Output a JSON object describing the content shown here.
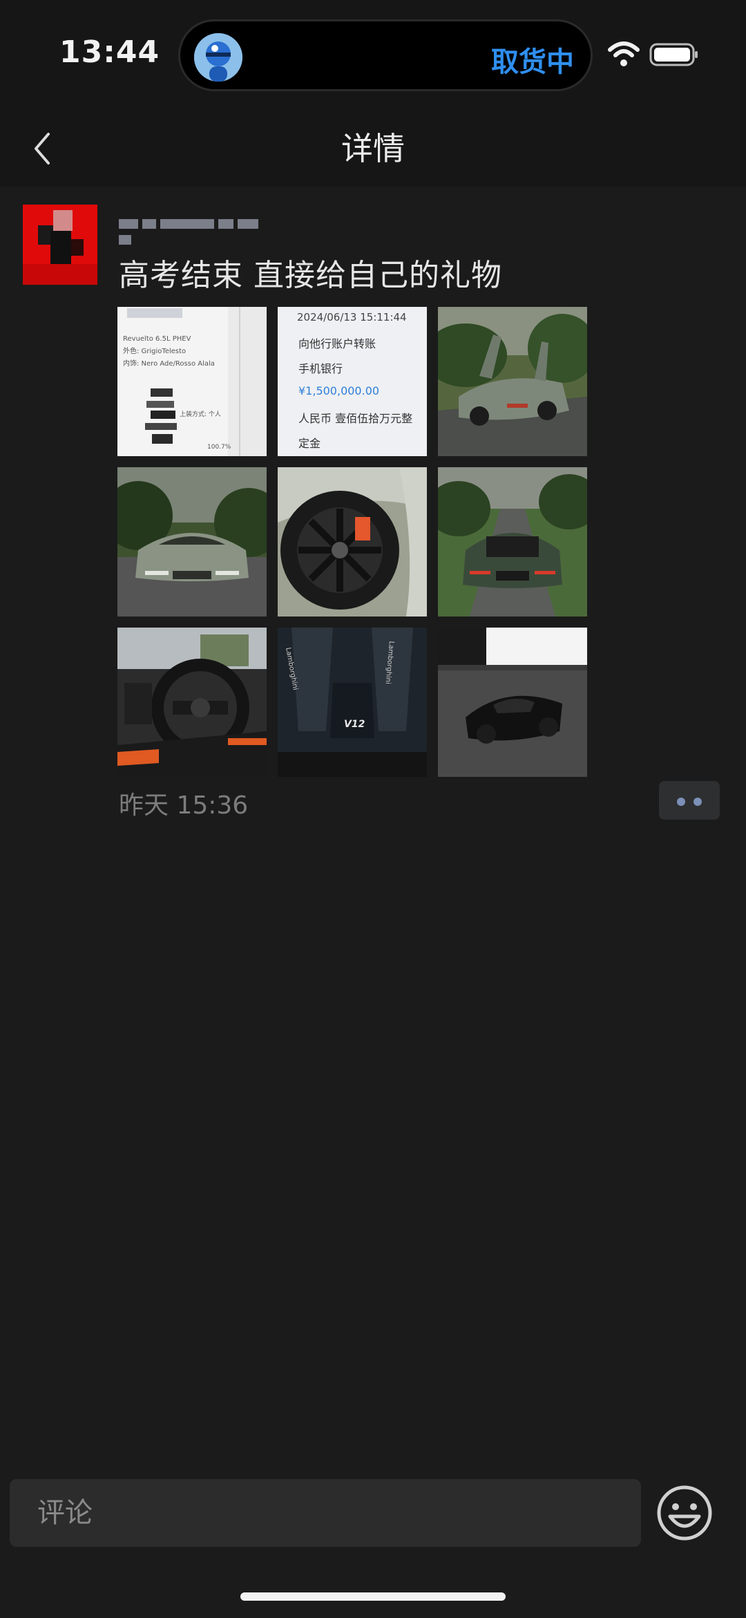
{
  "status_bar": {
    "time": "13:44",
    "island_status": "取货中"
  },
  "nav": {
    "title": "详情"
  },
  "post": {
    "text": "高考结束 直接给自己的礼物",
    "timestamp": "昨天 15:36",
    "photos": [
      {
        "kind": "receipt",
        "lines": [
          "Revuelto 6.5L PHEV",
          "外色: GrigioTelesto",
          "内饰: Nero Ade/Rosso Alala",
          "上装方式: 个人",
          "100.7%"
        ]
      },
      {
        "kind": "transfer",
        "lines": [
          "2024/06/13 15:11:44",
          "向他行账户转账",
          "手机银行",
          "¥1,500,000.00",
          "人民币 壹佰伍拾万元整",
          "定金"
        ]
      },
      {
        "kind": "car-doors-open"
      },
      {
        "kind": "car-front"
      },
      {
        "kind": "car-wheel"
      },
      {
        "kind": "car-rear"
      },
      {
        "kind": "car-interior"
      },
      {
        "kind": "engine-cover",
        "lines": [
          "Lamborghini",
          "Lamborghini",
          "V12"
        ]
      },
      {
        "kind": "car-black"
      }
    ]
  },
  "comment": {
    "placeholder": "评论"
  }
}
